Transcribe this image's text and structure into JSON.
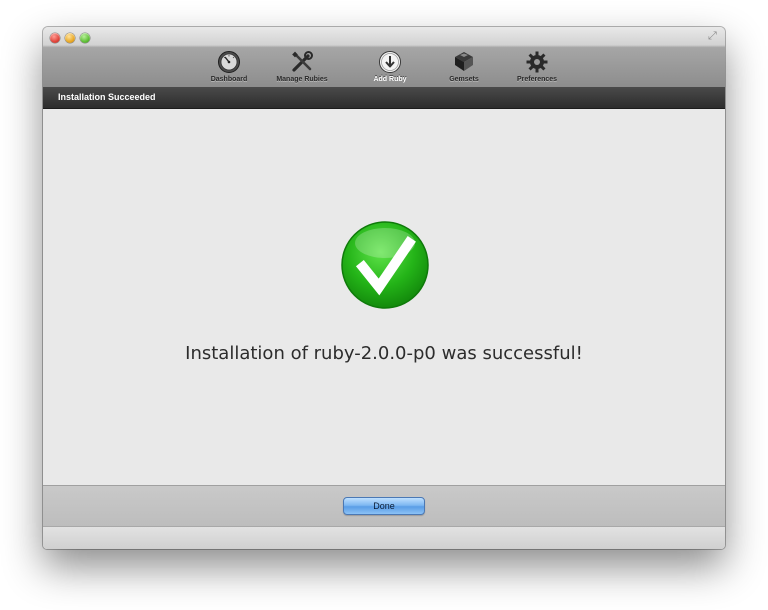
{
  "toolbar": {
    "items": [
      {
        "label": "Dashboard",
        "icon": "dashboard-gauge-icon"
      },
      {
        "label": "Manage Rubies",
        "icon": "tools-icon"
      },
      {
        "label": "Add Ruby",
        "icon": "download-arrow-icon",
        "active": true
      },
      {
        "label": "Gemsets",
        "icon": "gemset-icon"
      },
      {
        "label": "Preferences",
        "icon": "gear-icon"
      }
    ]
  },
  "status": {
    "title": "Installation Succeeded"
  },
  "main": {
    "success_icon": "checkmark-icon",
    "message": "Installation of ruby-2.0.0-p0 was successful!"
  },
  "footer": {
    "done_label": "Done"
  },
  "colors": {
    "success_green": "#2fb31a",
    "accent_blue": "#6aa8ec"
  }
}
